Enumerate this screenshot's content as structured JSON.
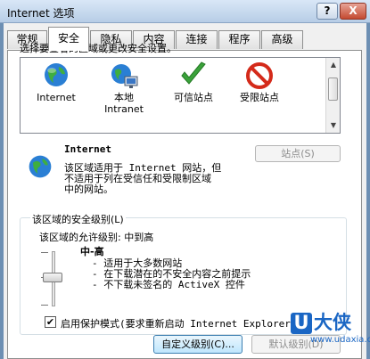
{
  "window": {
    "title": "Internet 选项",
    "help_label": "?",
    "close_label": "X"
  },
  "tabs": [
    {
      "label": "常规"
    },
    {
      "label": "安全",
      "active": true
    },
    {
      "label": "隐私"
    },
    {
      "label": "内容"
    },
    {
      "label": "连接"
    },
    {
      "label": "程序"
    },
    {
      "label": "高级"
    }
  ],
  "zones": {
    "prompt": "选择要查看的区域或更改安全设置。",
    "items": [
      {
        "label": "Internet",
        "icon": "globe-icon"
      },
      {
        "label": "本地",
        "label2": "Intranet",
        "icon": "intranet-icon"
      },
      {
        "label": "可信站点",
        "icon": "checkmark-icon"
      },
      {
        "label": "受限站点",
        "icon": "restricted-icon"
      }
    ],
    "selected": "Internet"
  },
  "zone_info": {
    "title": "Internet",
    "description_lines": [
      "该区域适用于 Internet 网站，但",
      "不适用于列在受信任和受限制区域",
      "中的网站。"
    ],
    "sites_button": "站点(S)"
  },
  "security_level": {
    "group_label": "该区域的安全级别(L)",
    "allowed_label": "该区域的允许级别: 中到高",
    "level_name": "中-高",
    "slider_level": "中-高",
    "bullets": [
      "- 适用于大多数网站",
      "- 在下载潜在的不安全内容之前提示",
      "- 不下载未签名的 ActiveX 控件"
    ],
    "protected_mode_label": "启用保护模式(要求重新启动 Internet Explorer)(",
    "protected_mode_checked": true,
    "custom_button": "自定义级别(C)...",
    "default_button": "默认级别(D)"
  },
  "watermark": {
    "logo_u": "U",
    "logo_text": "大侠",
    "url": "www.udaxia.com"
  },
  "colors": {
    "accent": "#1a66c4",
    "check_green": "#3aa23a",
    "restricted_red": "#d42a1a"
  }
}
